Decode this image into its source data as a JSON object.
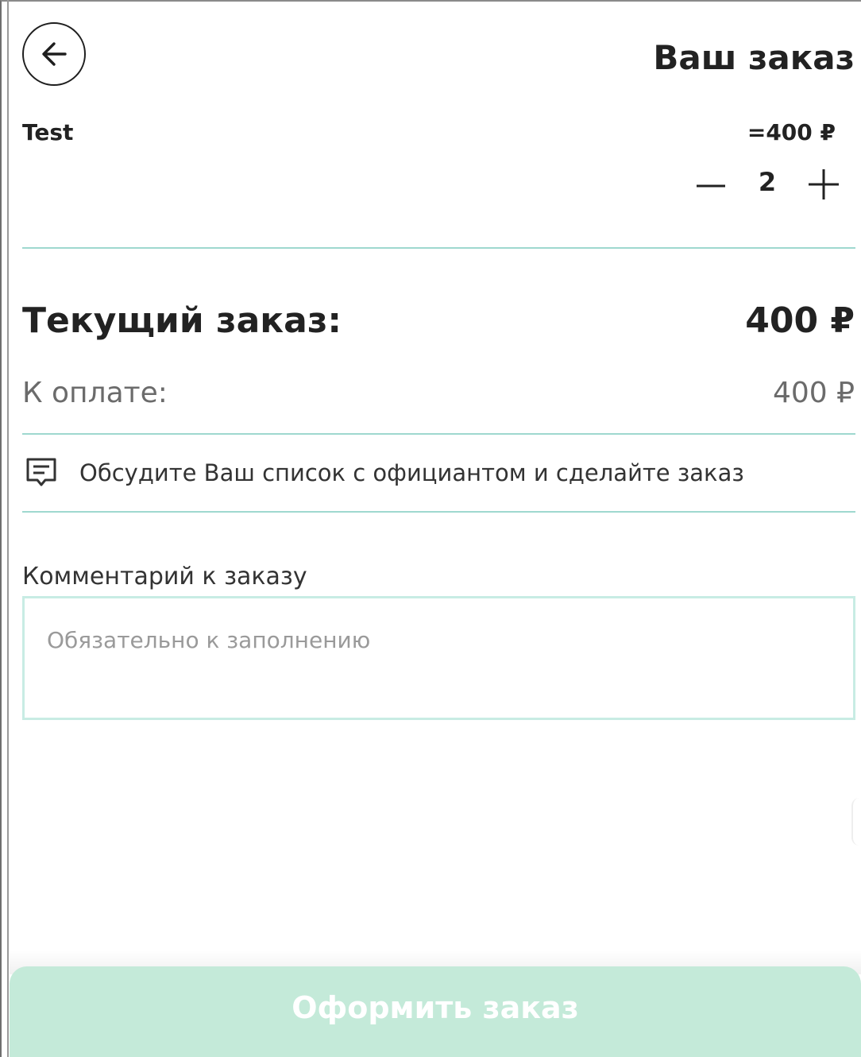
{
  "header": {
    "title": "Ваш заказ",
    "back_icon": "arrow-left-icon"
  },
  "cart": {
    "items": [
      {
        "name": "Test",
        "price": "=400 ₽",
        "quantity": "2",
        "minus_icon": "minus-icon",
        "plus_icon": "plus-icon"
      }
    ]
  },
  "summary": {
    "current_label": "Текущий заказ:",
    "current_value": "400 ₽",
    "pay_label": "К оплате:",
    "pay_value": "400 ₽"
  },
  "notice": {
    "icon": "message-icon",
    "text": "Обсудите Ваш список с официантом и сделайте заказ"
  },
  "comment": {
    "label": "Комментарий к заказу",
    "placeholder": "Обязательно к заполнению",
    "value": ""
  },
  "footer": {
    "submit_label": "Оформить заказ"
  },
  "colors": {
    "accent_line": "#9fd8cf",
    "field_border": "#c8ece4",
    "button_disabled": "#c4ead9",
    "text_primary": "#222222",
    "text_muted": "#6b6b6b"
  }
}
